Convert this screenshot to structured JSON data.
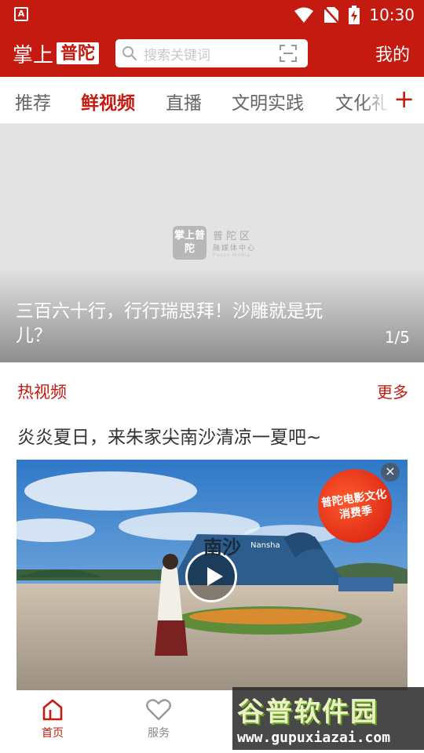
{
  "status_bar": {
    "left_icon_letter": "A",
    "time": "10:30"
  },
  "header": {
    "logo_part1": "掌上",
    "logo_part2": "普陀",
    "search_placeholder": "搜索关键词",
    "mine_label": "我的"
  },
  "tabs": [
    {
      "label": "推荐",
      "active": false
    },
    {
      "label": "鲜视频",
      "active": true
    },
    {
      "label": "直播",
      "active": false
    },
    {
      "label": "文明实践",
      "active": false
    },
    {
      "label": "文化礼",
      "active": false
    }
  ],
  "tab_add_label": "+",
  "banner": {
    "placeholder_logo_box": "掌上普陀",
    "placeholder_line1": "普陀区",
    "placeholder_line2": "融媒体中心",
    "placeholder_line3": "Putuo Media",
    "caption": "三百六十行，行行瑞思拜！沙雕就是玩儿？",
    "counter": "1/5"
  },
  "section": {
    "title": "热视频",
    "more_label": "更多"
  },
  "video": {
    "title": "炎炎夏日，来朱家尖南沙清凉一夏吧~",
    "sign_text": "南沙",
    "sign_sub": "Nansha",
    "promo_badge": "普陀电影文化消费季"
  },
  "bottom_nav": [
    {
      "label": "首页",
      "icon": "home-icon",
      "active": true
    },
    {
      "label": "服务",
      "icon": "heart-icon",
      "active": false
    }
  ],
  "watermark": {
    "title": "谷普软件园",
    "url": "www.gupuxiazai.com"
  },
  "colors": {
    "brand_red": "#c41a10",
    "tab_inactive": "#666666"
  }
}
